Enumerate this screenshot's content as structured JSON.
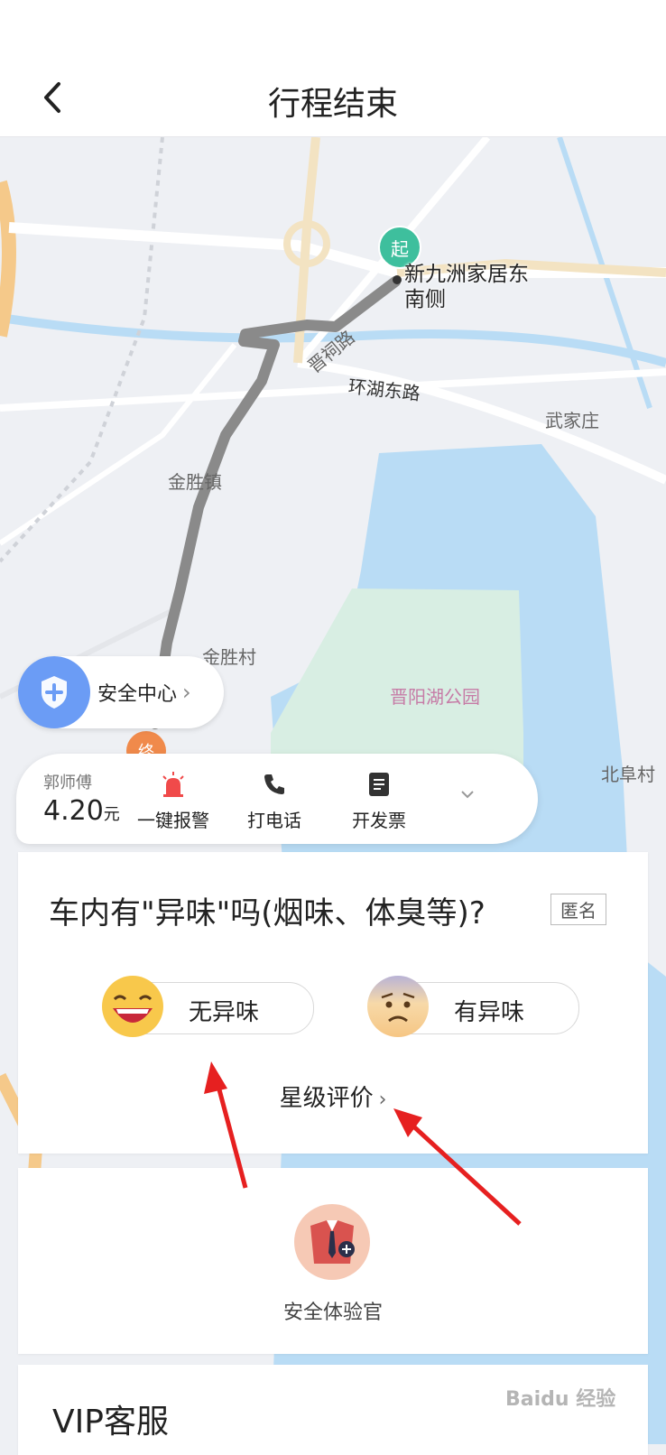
{
  "header": {
    "title": "行程结束"
  },
  "map": {
    "labels": {
      "start_marker": "起",
      "start_name_line1": "新九洲家居东",
      "start_name_line2": "南侧",
      "road_jinci": "晋祠路",
      "road_huanhu_east": "环湖东路",
      "wujiazhuang": "武家庄",
      "jinsheng_town": "金胜镇",
      "jinsheng_village": "金胜村",
      "park": "晋阳湖公园",
      "beifu_village": "北阜村",
      "end_marker": "终"
    },
    "colors": {
      "water": "#b9dcf5",
      "park": "#d8eee3",
      "road_major": "#f5c98a",
      "route": "#8a8a8a"
    }
  },
  "safety_center": {
    "label": "安全中心",
    "chevron": "›"
  },
  "driver": {
    "name": "郭师傅",
    "fare": "4.20",
    "currency": "元",
    "actions": [
      {
        "label": "一键报警",
        "icon": "alarm-light-icon"
      },
      {
        "label": "打电话",
        "icon": "phone-icon"
      },
      {
        "label": "开发票",
        "icon": "invoice-icon"
      }
    ],
    "more_icon": "chevron-down-icon"
  },
  "odor_survey": {
    "question": "车内有\"异味\"吗(烟味、体臭等)?",
    "anonymous_tag": "匿名",
    "options": [
      {
        "label": "无异味",
        "icon": "laughing-face-icon"
      },
      {
        "label": "有异味",
        "icon": "sad-face-icon"
      }
    ],
    "star_rating_link": "星级评价",
    "star_rating_chevron": "›"
  },
  "safety_officer": {
    "label": "安全体验官",
    "icon": "suit-badge-icon"
  },
  "vip": {
    "title": "VIP客服"
  },
  "watermark": "Baidu 经验"
}
